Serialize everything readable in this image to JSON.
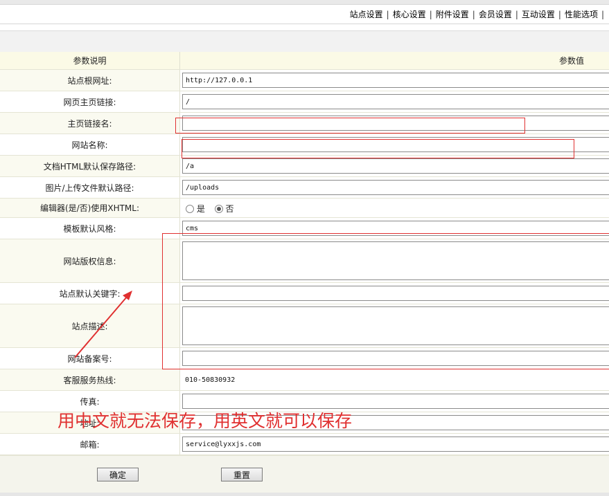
{
  "nav": {
    "items": [
      "站点设置",
      "核心设置",
      "附件设置",
      "会员设置",
      "互动设置",
      "性能选项"
    ],
    "separator": "|"
  },
  "table": {
    "header_label": "参数说明",
    "header_value": "参数值"
  },
  "fields": {
    "site_root_url": {
      "label": "站点根网址:",
      "value": "http://127.0.0.1"
    },
    "home_link": {
      "label": "网页主页链接:",
      "value": "/"
    },
    "home_link_name": {
      "label": "主页链接名:",
      "value": ""
    },
    "site_name": {
      "label": "网站名称:",
      "value": ""
    },
    "html_path": {
      "label": "文档HTML默认保存路径:",
      "value": "/a"
    },
    "upload_path": {
      "label": "图片/上传文件默认路径:",
      "value": "/uploads"
    },
    "editor_xhtml": {
      "label": "编辑器(是/否)使用XHTML:",
      "option_yes": "是",
      "option_no": "否",
      "selected": "否"
    },
    "template_style": {
      "label": "模板默认风格:",
      "value": "cms"
    },
    "copyright": {
      "label": "网站版权信息:",
      "value": ""
    },
    "keywords": {
      "label": "站点默认关键字:",
      "value": ""
    },
    "description": {
      "label": "站点描述:",
      "value": ""
    },
    "icp": {
      "label": "网站备案号:",
      "value": ""
    },
    "hotline": {
      "label": "客服服务热线:",
      "value": "010-50830932"
    },
    "fax": {
      "label": "传真:",
      "value": ""
    },
    "address": {
      "label": "地址:",
      "value": ""
    },
    "email": {
      "label": "邮箱:",
      "value": "service@lyxxjs.com"
    }
  },
  "buttons": {
    "confirm": "确定",
    "reset": "重置"
  },
  "annotation": {
    "text": "用中文就无法保存，用英文就可以保存",
    "color": "#e03030"
  }
}
